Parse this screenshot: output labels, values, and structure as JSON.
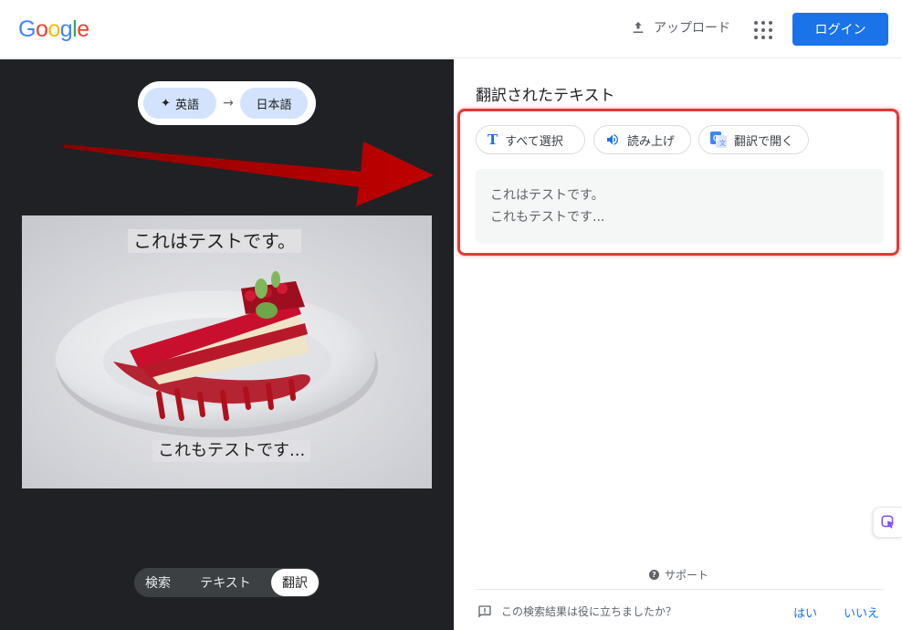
{
  "header": {
    "logo_letters": [
      {
        "ch": "G",
        "color": "#4285F4"
      },
      {
        "ch": "o",
        "color": "#EA4335"
      },
      {
        "ch": "o",
        "color": "#FBBC05"
      },
      {
        "ch": "g",
        "color": "#4285F4"
      },
      {
        "ch": "l",
        "color": "#34A853"
      },
      {
        "ch": "e",
        "color": "#EA4335"
      }
    ],
    "upload_label": "アップロード",
    "apps_icon": "apps-grid-icon",
    "login_label": "ログイン"
  },
  "left": {
    "source_lang": "英語",
    "target_lang": "日本語",
    "image_text_top": "これはテストです。",
    "image_text_bottom": "これもテストです...",
    "modes": [
      "検索",
      "テキスト",
      "翻訳"
    ],
    "active_mode": "翻訳"
  },
  "right": {
    "title": "翻訳されたテキスト",
    "actions": {
      "select_all": "すべて選択",
      "read_aloud": "読み上げ",
      "open_in_translate": "翻訳で開く"
    },
    "result_lines": [
      "これはテストです。",
      "これもテストです..."
    ],
    "support_label": "サポート",
    "feedback_question": "この検索結果は役に立ちましたか？",
    "feedback_yes": "はい",
    "feedback_no": "いいえ"
  },
  "colors": {
    "accent": "#1a73e8",
    "dark_panel": "#202124",
    "highlight": "#e53935",
    "arrow": "#b00000"
  }
}
